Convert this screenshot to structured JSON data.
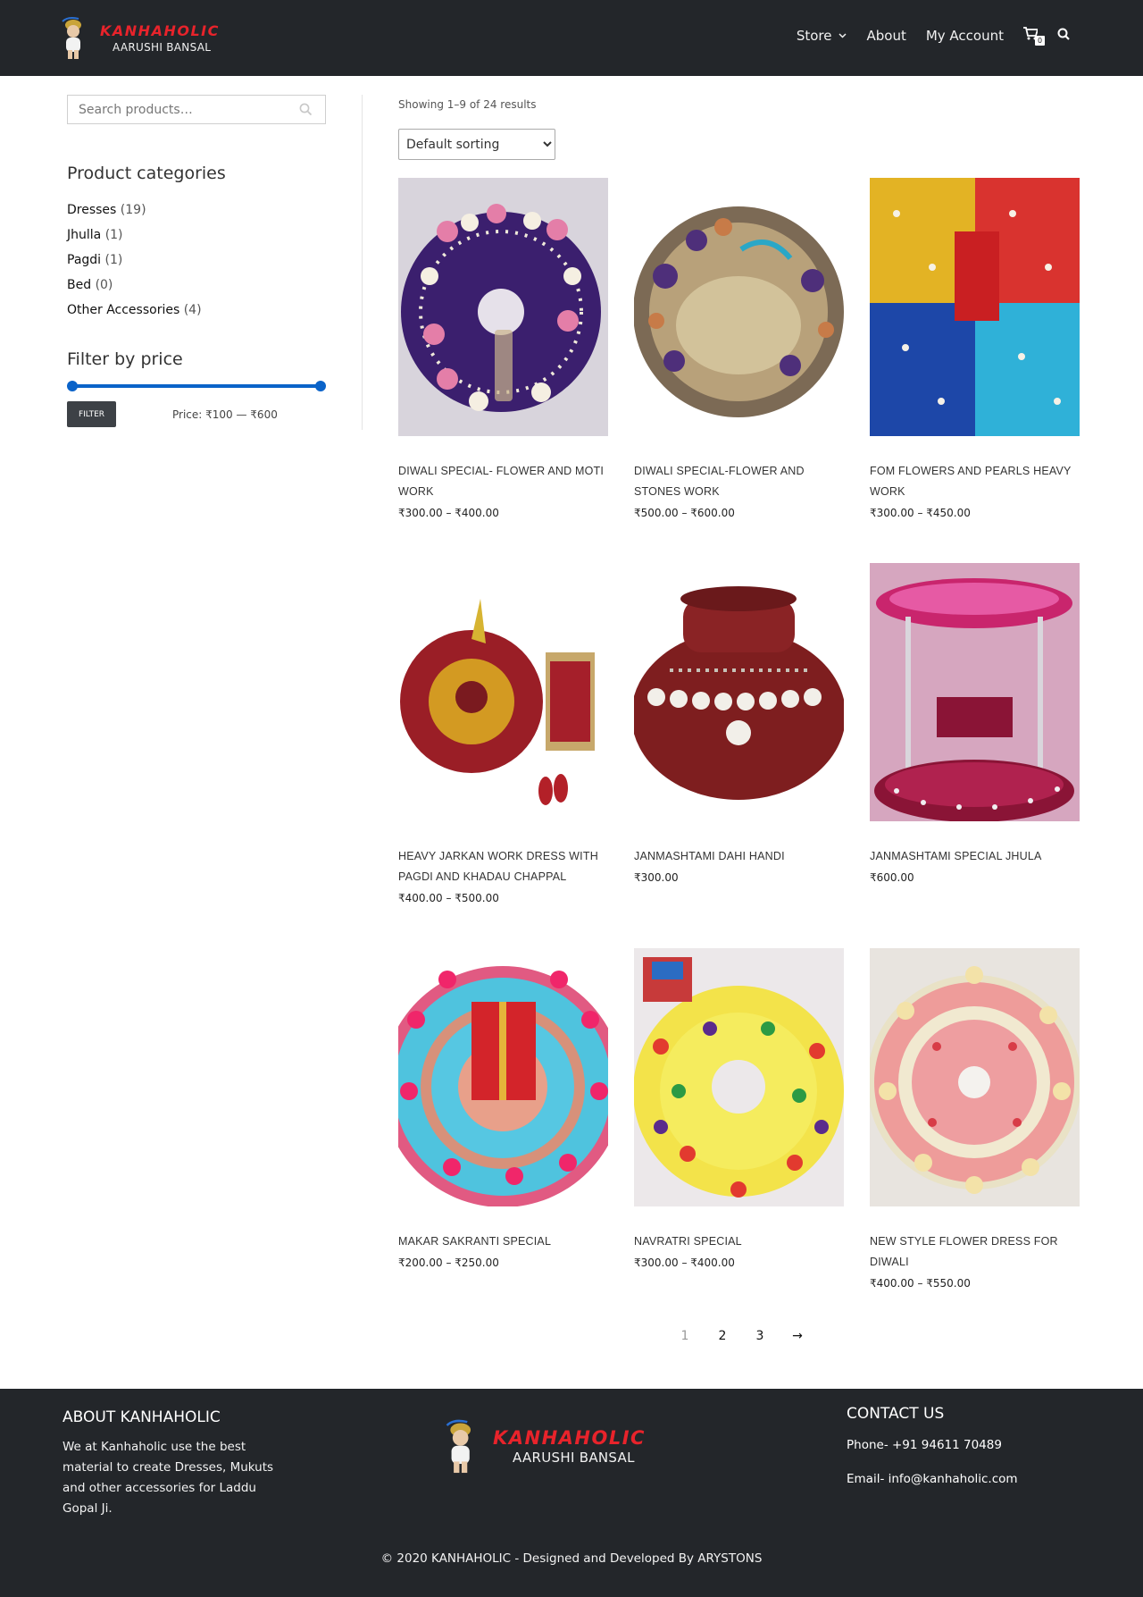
{
  "header": {
    "logo_brand": "KANHAHOLIC",
    "logo_sub": "AARUSHI BANSAL",
    "nav": [
      {
        "label": "Store",
        "has_dropdown": true
      },
      {
        "label": "About"
      },
      {
        "label": "My Account"
      }
    ],
    "cart_count": "0",
    "icons": {
      "cart": "cart-icon",
      "search": "search-icon",
      "dropdown": "chevron-down-icon"
    }
  },
  "sidebar": {
    "search_placeholder": "Search products…",
    "categories_title": "Product categories",
    "categories": [
      {
        "name": "Dresses",
        "count": "(19)"
      },
      {
        "name": "Jhulla",
        "count": "(1)"
      },
      {
        "name": "Pagdi",
        "count": "(1)"
      },
      {
        "name": "Bed",
        "count": "(0)"
      },
      {
        "name": "Other Accessories",
        "count": "(4)"
      }
    ],
    "price_title": "Filter by price",
    "price_min": 100,
    "price_max": 600,
    "filter_label": "FILTER",
    "price_label": "Price: ₹100 — ₹600",
    "accent_color": "#0a63c9"
  },
  "main": {
    "result_count": "Showing 1–9 of 24 results",
    "sorting": "Default sorting",
    "products": [
      {
        "name": "DIWALI SPECIAL- FLOWER AND MOTI WORK",
        "price": "₹300.00 – ₹400.00"
      },
      {
        "name": "DIWALI SPECIAL-FLOWER AND STONES WORK",
        "price": "₹500.00 – ₹600.00"
      },
      {
        "name": "FOM FLOWERS AND PEARLS HEAVY WORK",
        "price": "₹300.00 – ₹450.00"
      },
      {
        "name": "HEAVY JARKAN WORK DRESS WITH PAGDI AND KHADAU CHAPPAL",
        "price": "₹400.00 – ₹500.00"
      },
      {
        "name": "JANMASHTAMI DAHI HANDI",
        "price": "₹300.00"
      },
      {
        "name": "JANMASHTAMI SPECIAL JHULA",
        "price": "₹600.00"
      },
      {
        "name": "MAKAR SAKRANTI SPECIAL",
        "price": "₹200.00 – ₹250.00"
      },
      {
        "name": "NAVRATRI SPECIAL",
        "price": "₹300.00 – ₹400.00"
      },
      {
        "name": "NEW STYLE FLOWER DRESS FOR DIWALI",
        "price": "₹400.00 – ₹550.00"
      }
    ],
    "pagination": {
      "pages": [
        "1",
        "2",
        "3"
      ],
      "next": "→",
      "current": "1"
    }
  },
  "footer": {
    "about_title": "ABOUT KANHAHOLIC",
    "about_text": "We at Kanhaholic use the best material to create Dresses, Mukuts and other accessories for Laddu Gopal Ji.",
    "logo_brand": "KANHAHOLIC",
    "logo_sub": "AARUSHI BANSAL",
    "contact_title": "CONTACT US",
    "phone": "Phone- +91 94611 70489",
    "email": "Email- info@kanhaholic.com",
    "copyright": "© 2020 KANHAHOLIC - Designed and Developed By ARYSTONS"
  }
}
